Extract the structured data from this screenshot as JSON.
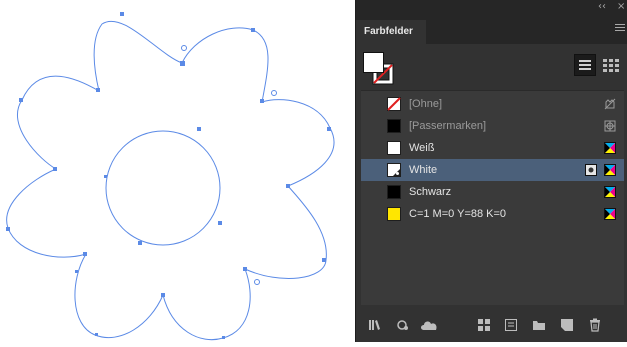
{
  "panel": {
    "tab_label": "Farbfelder",
    "collapse_glyph": "‹‹",
    "close_glyph": "×"
  },
  "swatches": [
    {
      "name": "[Ohne]",
      "fill": "none",
      "dimmed": true,
      "right_icon": "no-edit-icon"
    },
    {
      "name": "[Passermarken]",
      "fill": "#000000",
      "dimmed": true,
      "right_icon": "registration-icon"
    },
    {
      "name": "Weiß",
      "fill": "#ffffff",
      "dimmed": false,
      "right_icon": "cmyk-icon"
    },
    {
      "name": "White",
      "fill": "#ffffff",
      "dimmed": false,
      "selected": true,
      "right_icon": "cmyk-icon"
    },
    {
      "name": "Schwarz",
      "fill": "#000000",
      "dimmed": false,
      "right_icon": "cmyk-icon"
    },
    {
      "name": "C=1 M=0 Y=88 K=0",
      "fill": "#ffe600",
      "dimmed": false,
      "right_icon": "cmyk-icon"
    }
  ],
  "colors": {
    "path": "#5b8ae6",
    "panel_bg": "#323232",
    "selection": "#4b607a"
  },
  "bottom_icons": [
    "swatch-libraries-icon",
    "show-kinds-icon",
    "cc-libraries-icon",
    "swatch-options-grid-icon",
    "new-color-group-icon",
    "folder-icon",
    "new-swatch-icon",
    "trash-icon"
  ]
}
